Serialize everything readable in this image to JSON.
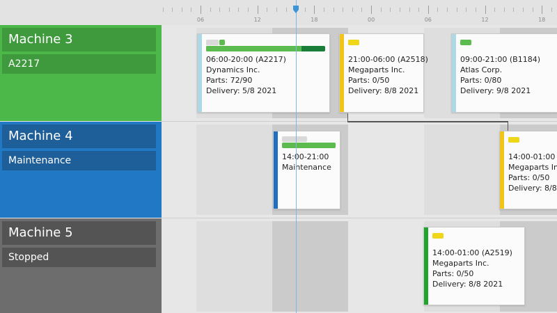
{
  "timeline": {
    "tick_labels": [
      "06",
      "12",
      "18",
      "00",
      "06",
      "12",
      "18"
    ]
  },
  "machines": [
    {
      "name": "Machine 3",
      "status": "A2217",
      "color": "#4db84a"
    },
    {
      "name": "Machine 4",
      "status": "Maintenance",
      "color": "#2179c6"
    },
    {
      "name": "Machine 5",
      "status": "Stopped",
      "color": "#6d6d6d"
    }
  ],
  "jobs": {
    "a2217": {
      "time": "06:00-20:00 (A2217)",
      "customer": "Dynamics Inc.",
      "parts": "Parts: 72/90",
      "delivery": "Delivery: 5/8 2021",
      "accent": "#add8e6",
      "tag_color": "#5bbb4f",
      "progress": 0.8
    },
    "a2518": {
      "time": "21:00-06:00 (A2518)",
      "customer": "Megaparts Inc.",
      "parts": "Parts: 0/50",
      "delivery": "Delivery: 8/8 2021",
      "accent": "#f0c419",
      "tag_color": "#f0d619"
    },
    "b1184": {
      "time": "09:00-21:00 (B1184)",
      "customer": "Atlas Corp.",
      "parts": "Parts: 0/80",
      "delivery": "Delivery: 9/8 2021",
      "accent": "#add8e6",
      "tag_color": "#5bbb4f"
    },
    "maintenance": {
      "time": "14:00-21:00",
      "label": "Maintenance",
      "accent": "#1f6fc0",
      "progress": 1.0
    },
    "next": {
      "time": "14:00-01:00 (",
      "customer": "Megaparts Inc",
      "parts": "Parts: 0/50",
      "delivery": "Delivery: 8/8 2",
      "accent": "#f0c419",
      "tag_color": "#f0d619"
    },
    "a2519": {
      "time": "14:00-01:00 (A2519)",
      "customer": "Megaparts Inc.",
      "parts": "Parts: 0/50",
      "delivery": "Delivery: 8/8 2021",
      "accent": "#1fa52e",
      "tag_color": "#f0d619"
    }
  }
}
